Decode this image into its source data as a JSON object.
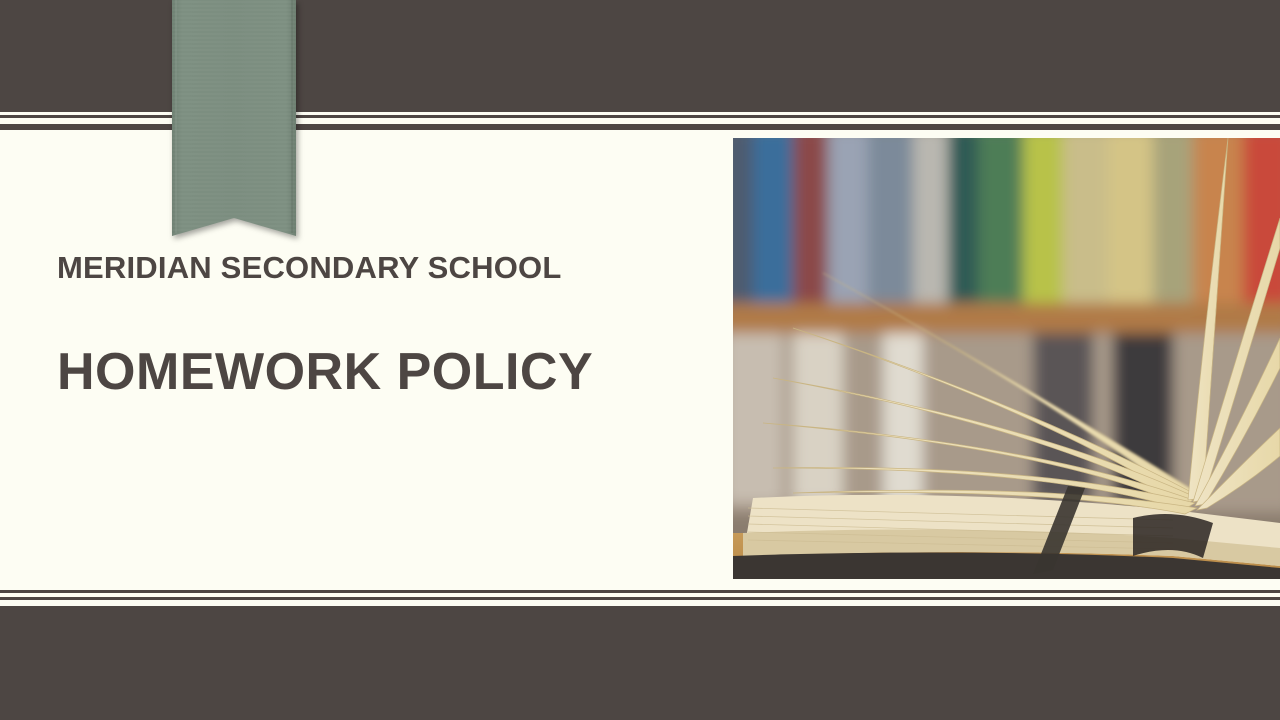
{
  "slide": {
    "school_name": "MERIDIAN SECONDARY SCHOOL",
    "title": "HOMEWORK POLICY"
  },
  "theme": {
    "band_color": "#4d4643",
    "content_bg": "#fdfdf3",
    "ribbon_color": "#7a8c7e",
    "text_color": "#4d4643"
  },
  "icons": {
    "ribbon": "bookmark-ribbon-icon",
    "photo": "open-book-photo"
  }
}
